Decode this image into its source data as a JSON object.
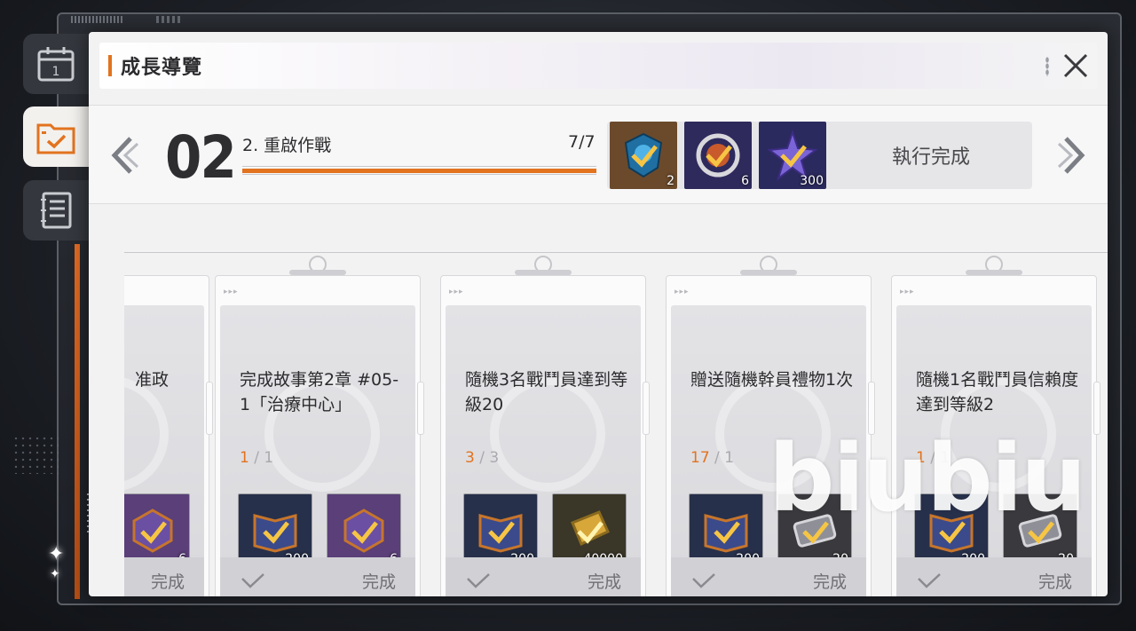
{
  "header": {
    "title": "成長導覽"
  },
  "stage": {
    "number": "02",
    "name": "2. 重啟作戰",
    "progress_text": "7/7",
    "progress_fraction": 1.0,
    "rewards": [
      {
        "icon": "badge-shield-icon",
        "qty": "2",
        "color": "#6b4a2b"
      },
      {
        "icon": "gear-medal-icon",
        "qty": "6",
        "color": "#2e2a5c"
      },
      {
        "icon": "star-crystal-icon",
        "qty": "300",
        "color": "#2b2a5e"
      }
    ],
    "done_label": "執行完成"
  },
  "cards": [
    {
      "desc": "准政",
      "count_cur": "",
      "count_total": "",
      "rewards": [
        {
          "icon": "medal-box-icon",
          "qty": "6",
          "color": "#5a3f78"
        }
      ],
      "footer": "完成",
      "partial": true
    },
    {
      "desc": "完成故事第2章 #05-1「治療中心」",
      "count_cur": "1",
      "count_total": "1",
      "rewards": [
        {
          "icon": "book-icon",
          "qty": "200",
          "color": "#27304a"
        },
        {
          "icon": "medal-box-icon",
          "qty": "6",
          "color": "#5a3f78"
        }
      ],
      "footer": "完成"
    },
    {
      "desc": "隨機3名戰鬥員達到等級20",
      "count_cur": "3",
      "count_total": "3",
      "rewards": [
        {
          "icon": "book-icon",
          "qty": "200",
          "color": "#27304a"
        },
        {
          "icon": "gold-bar-icon",
          "qty": "40000",
          "color": "#3a3628"
        }
      ],
      "footer": "完成"
    },
    {
      "desc": "贈送隨機幹員禮物1次",
      "count_cur": "17",
      "count_total": "1",
      "rewards": [
        {
          "icon": "book-icon",
          "qty": "200",
          "color": "#27304a"
        },
        {
          "icon": "ticket-icon",
          "qty": "20",
          "color": "#3a3a3e"
        }
      ],
      "footer": "完成"
    },
    {
      "desc": "隨機1名戰鬥員信賴度達到等級2",
      "count_cur": "1",
      "count_total": "1",
      "rewards": [
        {
          "icon": "book-icon",
          "qty": "200",
          "color": "#27304a"
        },
        {
          "icon": "ticket-icon",
          "qty": "20",
          "color": "#3a3a3e"
        }
      ],
      "footer": "完成"
    }
  ],
  "watermark": "biubiu",
  "colors": {
    "accent": "#e2731f",
    "panel": "#f2f2f3"
  }
}
